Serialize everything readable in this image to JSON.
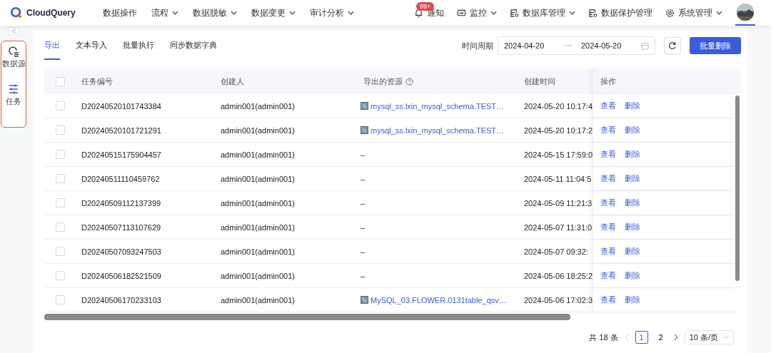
{
  "brand": {
    "name": "CloudQuery"
  },
  "nav": [
    {
      "label": "数据操作",
      "dropdown": false
    },
    {
      "label": "流程",
      "dropdown": true
    },
    {
      "label": "数据脱敏",
      "dropdown": true
    },
    {
      "label": "数据变更",
      "dropdown": true
    },
    {
      "label": "审计分析",
      "dropdown": true
    }
  ],
  "notify": {
    "label": "通知",
    "badge": "99+"
  },
  "nav_right": [
    {
      "label": "监控",
      "dropdown": true,
      "kind": "monitor"
    },
    {
      "label": "数据库管理",
      "dropdown": true,
      "kind": "database"
    },
    {
      "label": "数据保护管理",
      "dropdown": false,
      "kind": "database"
    },
    {
      "label": "系统管理",
      "dropdown": true,
      "kind": "settings"
    }
  ],
  "sidebar": {
    "items": [
      {
        "label": "数据源",
        "selected": false,
        "kind": "source"
      },
      {
        "label": "任务",
        "selected": true,
        "kind": "task"
      }
    ]
  },
  "tabs": [
    {
      "label": "导出",
      "selected": true
    },
    {
      "label": "文本导入",
      "selected": false
    },
    {
      "label": "批量执行",
      "selected": false
    },
    {
      "label": "同步数据字典",
      "selected": false
    }
  ],
  "filter": {
    "label": "时间周期",
    "start": "2024-04-20",
    "end": "2024-05-20"
  },
  "batch_delete": "批量删除",
  "table": {
    "all_checked": false,
    "columns": [
      "任务编号",
      "创建人",
      "导出的资源",
      "创建时间",
      "操作"
    ],
    "rows": [
      {
        "id": "D20240520101743384",
        "creator": "admin001(admin001)",
        "resource": {
          "kind": "link",
          "text": "mysql_ss.lxin_mysql_schema.TEST…"
        },
        "time": "2024-05-20 10:17:4",
        "actions": [
          "查看",
          "删除"
        ],
        "checked": false
      },
      {
        "id": "D20240520101721291",
        "creator": "admin001(admin001)",
        "resource": {
          "kind": "link",
          "text": "mysql_ss.lxin_mysql_schema.TEST…"
        },
        "time": "2024-05-20 10:17:2",
        "actions": [
          "查看",
          "删除"
        ],
        "checked": false
      },
      {
        "id": "D20240515175904457",
        "creator": "admin001(admin001)",
        "resource": {
          "kind": "none",
          "text": "–"
        },
        "time": "2024-05-15 17:59:0",
        "actions": [
          "查看",
          "删除"
        ],
        "checked": false
      },
      {
        "id": "D20240511110459762",
        "creator": "admin001(admin001)",
        "resource": {
          "kind": "none",
          "text": "–"
        },
        "time": "2024-05-11 11:04:5",
        "actions": [
          "查看",
          "删除"
        ],
        "checked": false
      },
      {
        "id": "D20240509112137399",
        "creator": "admin001(admin001)",
        "resource": {
          "kind": "none",
          "text": "–"
        },
        "time": "2024-05-09 11:21:3",
        "actions": [
          "查看",
          "删除"
        ],
        "checked": false
      },
      {
        "id": "D20240507113107629",
        "creator": "admin001(admin001)",
        "resource": {
          "kind": "none",
          "text": "–"
        },
        "time": "2024-05-07 11:31:0",
        "actions": [
          "查看",
          "删除"
        ],
        "checked": false
      },
      {
        "id": "D20240507093247503",
        "creator": "admin001(admin001)",
        "resource": {
          "kind": "none",
          "text": "–"
        },
        "time": "2024-05-07 09:32:",
        "actions": [
          "查看",
          "删除"
        ],
        "checked": false
      },
      {
        "id": "D20240506182521509",
        "creator": "admin001(admin001)",
        "resource": {
          "kind": "none",
          "text": "–"
        },
        "time": "2024-05-06 18:25:2",
        "actions": [
          "查看",
          "删除"
        ],
        "checked": false
      },
      {
        "id": "D20240506170233103",
        "creator": "admin001(admin001)",
        "resource": {
          "kind": "link",
          "text": "MySQL_03.FLOWER.0131table_qsv…"
        },
        "time": "2024-05-06 17:02:3",
        "actions": [
          "查看",
          "删除"
        ],
        "checked": false
      }
    ]
  },
  "pagination": {
    "total": "共 18 条",
    "pages": [
      {
        "label": "1",
        "selected": true
      },
      {
        "label": "2",
        "selected": false
      }
    ],
    "page_size": "10 条/页"
  }
}
